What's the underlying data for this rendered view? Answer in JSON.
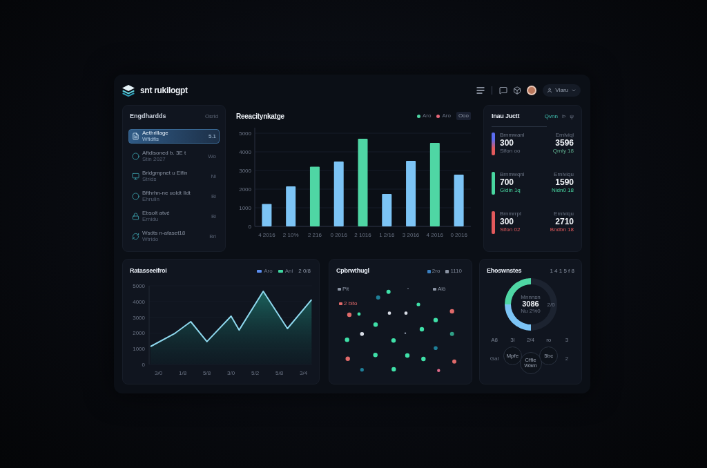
{
  "header": {
    "title": "snt rukilogpt",
    "account": "Vlaru"
  },
  "sidebar": {
    "title": "Engdhardds",
    "action": "Osrid",
    "items": [
      {
        "title": "Aethrillage",
        "subtitle": "Wfidfis",
        "value": "5.1",
        "selected": true
      },
      {
        "title": "Aftdisoned b. 3E t",
        "subtitle": "Stin 2027",
        "value": "Wo",
        "selected": false
      },
      {
        "title": "Bridgmpnet u Elfin",
        "subtitle": "Strids",
        "value": "Ni",
        "selected": false
      },
      {
        "title": "Bfthrhn-ne uoldt Ildt",
        "subtitle": "Ehrulin",
        "value": "Bi",
        "selected": false
      },
      {
        "title": "Ebsolt atvé",
        "subtitle": "Ernidu",
        "value": "Bi",
        "selected": false
      },
      {
        "title": "Wsdts n-afaset18",
        "subtitle": "Wtrido",
        "value": "Bri",
        "selected": false
      }
    ]
  },
  "bar_chart": {
    "title": "Reeacitynkatge",
    "legend": [
      {
        "label": "Aro",
        "color": "#4fd6a4"
      },
      {
        "label": "Aro",
        "color": "#e8677a"
      }
    ],
    "filter": "Ooo",
    "chart_data": {
      "type": "bar",
      "categories": [
        "4 2016",
        "2 10%",
        "2 216",
        "0 2016",
        "2 1016",
        "1 2/16",
        "3 2016",
        "4 2016",
        "0 2016"
      ],
      "series": [
        {
          "color": "#7cc4f5",
          "values": [
            1200,
            2150,
            null,
            3480,
            null,
            1740,
            3520,
            null,
            2780
          ]
        },
        {
          "color": "#4fd6a4",
          "values": [
            null,
            null,
            3200,
            null,
            4700,
            null,
            null,
            4480,
            null
          ]
        }
      ],
      "stacked": true,
      "grid": true,
      "ylim": [
        0,
        5000
      ],
      "yticks": [
        0,
        1000,
        2000,
        3000,
        4000,
        5000
      ]
    }
  },
  "summary": {
    "title": "Inau Juctt",
    "tabs": [
      {
        "label": "Qvnn",
        "selected": true
      },
      {
        "label": "Þ",
        "selected": false
      },
      {
        "label": "ψ",
        "selected": false
      }
    ],
    "rows": [
      {
        "segments": [
          {
            "color": "#5b6cf0"
          },
          {
            "color": "#e2595c"
          }
        ],
        "label": "Brnmwanl",
        "value": "300",
        "note": "Sifon oo",
        "side_label": "Ernlviql",
        "side_value": "3596",
        "side_note": "Qrnly 18"
      },
      {
        "segments": [
          {
            "color": "#48d6a0"
          }
        ],
        "label": "Brnmwqnl",
        "value": "700",
        "note": "Gidin 1q",
        "side_label": "Ernlviqu",
        "side_value": "1590",
        "side_note": "Nidn0 18"
      },
      {
        "segments": [
          {
            "color": "#e2595c"
          }
        ],
        "label": "Brnmrrpl",
        "value": "300",
        "note": "Sifon 02",
        "side_label": "Ernlviqu",
        "side_value": "2710",
        "side_note": "Bndbn 18"
      }
    ]
  },
  "line_chart": {
    "title": "Ratasseeifroi",
    "legend": [
      {
        "label": "Aro",
        "color": "#5b8def"
      },
      {
        "label": "Ani",
        "color": "#3fd6a0"
      }
    ],
    "period": "2 0/8",
    "chart_data": {
      "type": "area",
      "categories": [
        null,
        "3/0",
        null,
        null,
        "1/8",
        null,
        null,
        "5/8",
        null,
        null,
        "3/0",
        null,
        null,
        "5/2",
        null,
        null,
        "5/8",
        null,
        null,
        "3/4",
        null
      ],
      "series": [
        {
          "color": "#8fd8ee",
          "values": [
            1140,
            null,
            null,
            1970,
            null,
            2720,
            null,
            1450,
            null,
            null,
            3070,
            2190,
            null,
            null,
            4650,
            null,
            null,
            2280,
            null,
            null,
            4120
          ]
        }
      ],
      "grid": true,
      "ylim": [
        0,
        5000
      ],
      "yticks": [
        0,
        1000,
        2000,
        3000,
        4000,
        5000
      ]
    }
  },
  "scatter": {
    "title": "Cpbrwthugl",
    "legend": [
      {
        "label": "2ro",
        "color": "#3a7fc0"
      },
      {
        "label": "1110",
        "color": "#8a93a3"
      }
    ],
    "labels": [
      {
        "label": "Pit",
        "color": "#8a93a3"
      },
      {
        "label": "Alô",
        "color": "#8a93a3"
      },
      {
        "label": "2 bito",
        "color": "#e06a6a"
      }
    ]
  },
  "donut": {
    "title": "Ehoswnstes",
    "meta": "1 4 1 5 f 8",
    "center_label": "Mnnnsn",
    "center_value": "3086",
    "center_sub": "Nu 2%0",
    "ring_label": "2/0",
    "chart_data": {
      "type": "donut",
      "values": [
        50,
        25,
        25
      ],
      "colors": [
        "#1c2330",
        "#7cc4f5",
        "#4fd6a4"
      ]
    },
    "stats": [
      "A8",
      "3l",
      "2/4",
      "ro",
      "3"
    ],
    "bubbles": [
      "Mpfe",
      "Cffie Wam",
      "5bc"
    ],
    "footer": [
      "Gal",
      "2"
    ]
  }
}
